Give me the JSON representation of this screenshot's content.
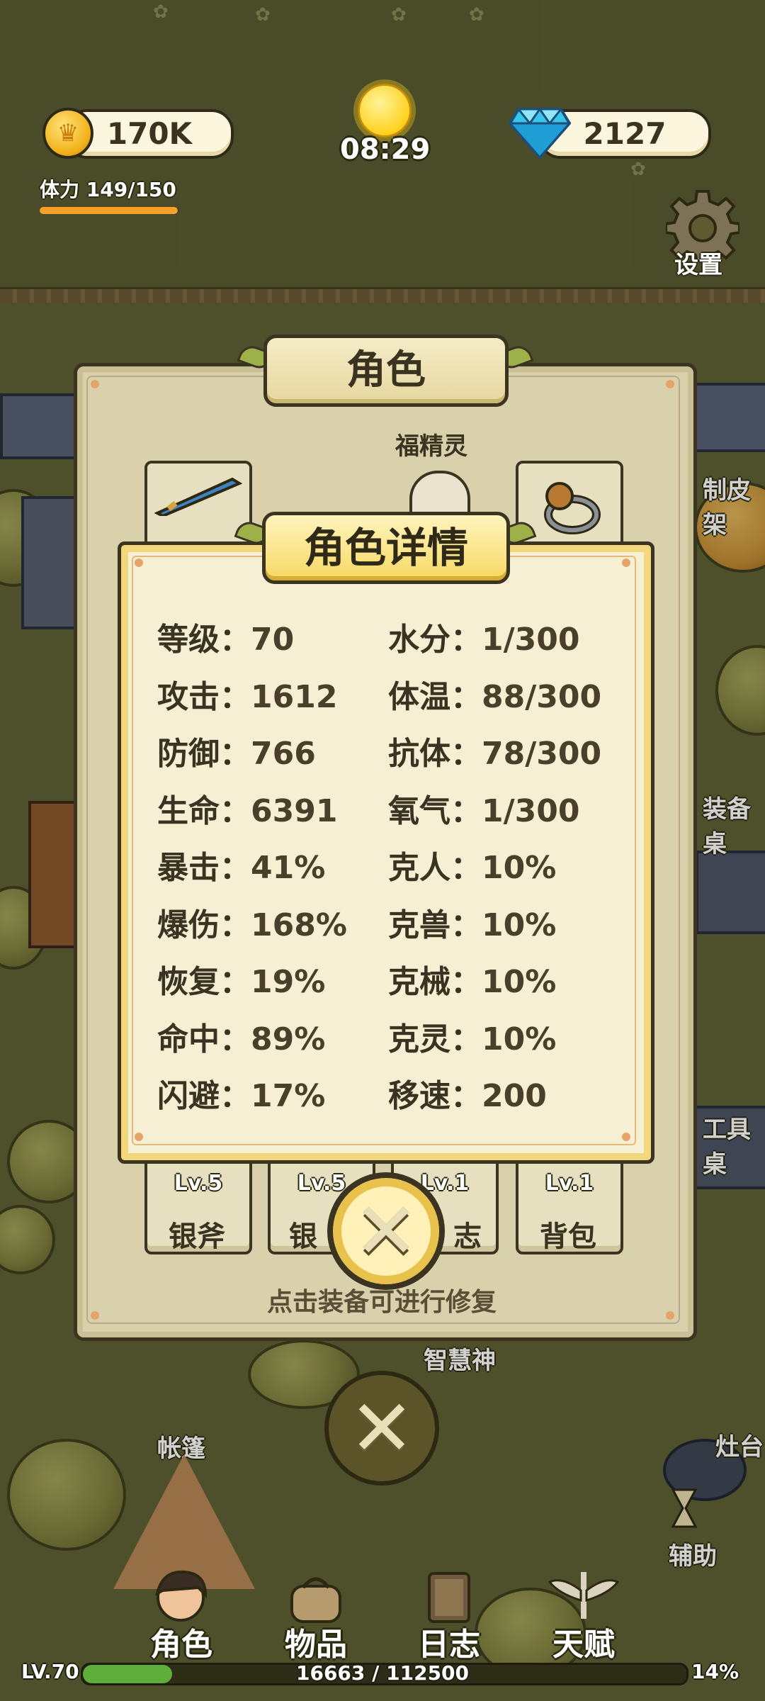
{
  "hud": {
    "coins": "170K",
    "gems": "2127",
    "clock": "08:29",
    "stamina_label": "体力",
    "stamina_value": "149/150",
    "stamina_fraction": 0.993,
    "settings_label": "设置"
  },
  "map_labels": {
    "leather": "制皮架",
    "equipment": "装备桌",
    "tool": "工具桌",
    "tent": "帐篷",
    "wisdom_god": "智慧神",
    "stove": "灶台",
    "assist": "辅助"
  },
  "role_panel": {
    "title": "角色",
    "spirit_label": "福精灵",
    "slots": [
      {
        "level": "Lv.5",
        "name": "银斧"
      },
      {
        "level": "Lv.5",
        "name": "银"
      },
      {
        "level": "Lv.1",
        "name": "志"
      },
      {
        "level": "Lv.1",
        "name": "背包"
      }
    ],
    "hint": "点击装备可进行修复"
  },
  "detail": {
    "title": "角色详情",
    "left": [
      {
        "label": "等级：",
        "value": "70"
      },
      {
        "label": "攻击：",
        "value": "1612"
      },
      {
        "label": "防御：",
        "value": "766"
      },
      {
        "label": "生命：",
        "value": "6391"
      },
      {
        "label": "暴击：",
        "value": "41%"
      },
      {
        "label": "爆伤：",
        "value": "168%"
      },
      {
        "label": "恢复：",
        "value": "19%"
      },
      {
        "label": "命中：",
        "value": "89%"
      },
      {
        "label": "闪避：",
        "value": "17%"
      }
    ],
    "right": [
      {
        "label": "水分：",
        "value": "1/300"
      },
      {
        "label": "体温：",
        "value": "88/300"
      },
      {
        "label": "抗体：",
        "value": "78/300"
      },
      {
        "label": "氧气：",
        "value": "1/300"
      },
      {
        "label": "克人：",
        "value": "10%"
      },
      {
        "label": "克兽：",
        "value": "10%"
      },
      {
        "label": "克械：",
        "value": "10%"
      },
      {
        "label": "克灵：",
        "value": "10%"
      },
      {
        "label": "移速：",
        "value": "200"
      }
    ]
  },
  "nav": {
    "items": [
      "角色",
      "物品",
      "日志",
      "天赋"
    ]
  },
  "xp": {
    "level": "LV.70",
    "progress": "16663 / 112500",
    "percent": "14%",
    "fraction": 0.148
  },
  "colors": {
    "coin": "#f2b21b",
    "gem": "#39c6ea",
    "xp": "#5fae3c",
    "stamina": "#f4a12a"
  }
}
